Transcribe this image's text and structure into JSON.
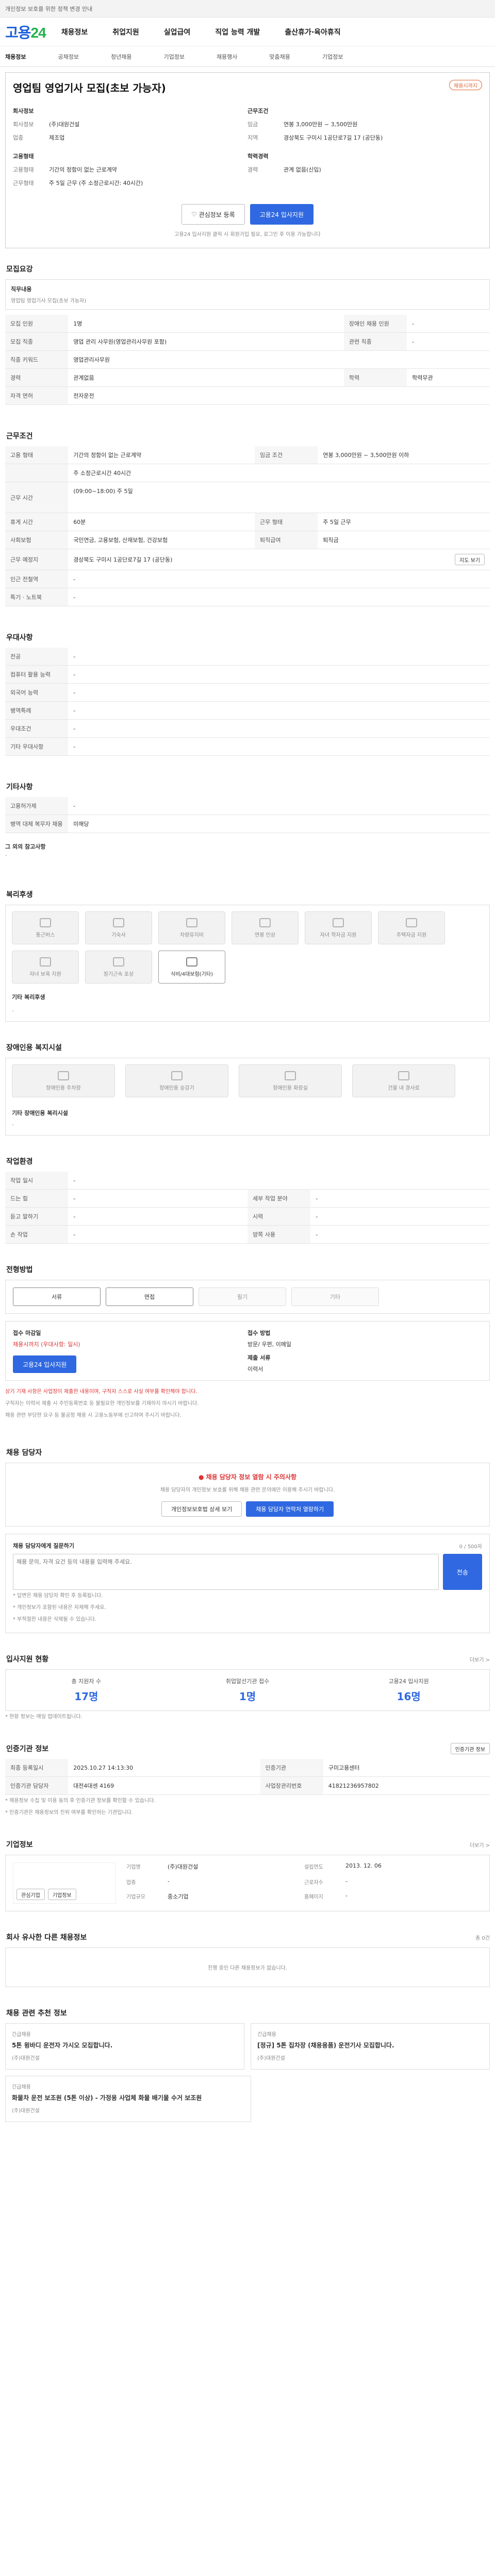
{
  "topbar": {
    "notice": "개인정보 보호를 위한 정책 변경 안내"
  },
  "gnb": {
    "logo_a": "고용",
    "logo_b": "24",
    "menu": [
      "채용정보",
      "취업지원",
      "실업급여",
      "직업 능력 개발",
      "출산휴가·육아휴직"
    ]
  },
  "sub": [
    "채용정보",
    "공채정보",
    "청년채용",
    "기업정보",
    "채용행사",
    "맞춤채용",
    "기업정보"
  ],
  "job": {
    "title": "영업팀 영업기사 모집(초보 가능자)",
    "badge": "채용시까지",
    "company_label": "회사정보",
    "company_name": "(주)대원건설",
    "company_type": "제조업",
    "cond_label": "근무조건",
    "pay_k": "임금",
    "pay": "연봉 3,000만원 ~ 3,500만원",
    "region_k": "지역",
    "region": "경상북도 구미시 1공단로7길 17 (공단동)",
    "emp_label": "고용형태",
    "emp_k1": "고용형태",
    "emp_v1": "기간의 정함이 없는 근로계약",
    "emp_k2": "근무형태",
    "emp_v2": "주 5일 근무 (주 소정근로시간: 40시간)",
    "career_label": "학력경력",
    "career_k": "경력",
    "career_v": "관계 없음(신입)",
    "btn_scrap": "관심정보 등록",
    "btn_apply": "고용24 입사지원",
    "apply_note": "고용24 입사지원 클릭 시 회원가입 필요, 로그인 후 이용 가능합니다"
  },
  "recruit": {
    "title": "모집요강",
    "duty_label": "직무내용",
    "duty_text": "영업팀 영업기사 모집(초보 가능자)",
    "rows": [
      [
        "모집 인원",
        "1명",
        "장애인 채용 인원",
        "-"
      ],
      [
        "모집 직종",
        "영업 관리 사무원(영업관리사무원 포함)",
        "관련 직종",
        "-"
      ],
      [
        "직종 키워드",
        "영업관리사무원",
        "",
        ""
      ],
      [
        "경력",
        "관계없음",
        "학력",
        "학력무관"
      ],
      [
        "자격 면허",
        "전자운전",
        "",
        ""
      ]
    ]
  },
  "work": {
    "title": "근무조건",
    "rows": [
      [
        "고용 형태",
        "기간의 정함이 없는 근로계약",
        "임금 조건",
        "연봉 3,000만원 ~ 3,500만원 이하"
      ],
      [
        "",
        "주 소정근로시간 40시간",
        "",
        ""
      ],
      [
        "근무 시간",
        "(09:00~18:00) 주 5일",
        "",
        ""
      ],
      [
        "휴게 시간",
        "60분",
        "근무 형태",
        "주 5일 근무"
      ],
      [
        "사회보험",
        "국민연금, 고용보험, 산재보험, 건강보험",
        "퇴직급여",
        "퇴직금"
      ],
      [
        "근무 예정지",
        "경상북도 구미시 1공단로7길 17 (공단동)",
        "",
        ""
      ],
      [
        "인근 전철역",
        "-",
        "",
        ""
      ],
      [
        "특기 · 노트북",
        "-",
        "",
        ""
      ]
    ],
    "map_btn": "지도 보기"
  },
  "prefer": {
    "title": "우대사항",
    "rows": [
      [
        "전공",
        "-"
      ],
      [
        "컴퓨터 활용 능력",
        "-"
      ],
      [
        "외국어 능력",
        "-"
      ],
      [
        "병역특례",
        "-"
      ],
      [
        "우대조건",
        "-"
      ],
      [
        "기타 우대사항",
        "-"
      ]
    ]
  },
  "other": {
    "title": "기타사항",
    "rows": [
      [
        "고용허가제",
        "-"
      ],
      [
        "병역 대체 복무자 채용",
        "미해당"
      ]
    ],
    "etc_label": "그 외의 참고사항"
  },
  "welfare": {
    "title": "복리후생",
    "tiles": [
      "통근버스",
      "기숙사",
      "차량유지비",
      "연봉 인상",
      "자녀 학자금 지원",
      "주택자금 지원",
      "자녀 보육 지원",
      "장기근속 포상",
      "식비/4대보험(기타)"
    ],
    "other_label": "기타 복리후생"
  },
  "disability": {
    "title": "장애인용 복지시설",
    "tiles": [
      "장애인용 주차장",
      "장애인용 승강기",
      "장애인용 화장실",
      "건물 내 경사로"
    ],
    "other_label": "기타 장애인용 복리시설"
  },
  "env": {
    "title": "작업환경",
    "rows": [
      [
        "작업 일시",
        "-",
        "",
        ""
      ],
      [
        "드는 힘",
        "-",
        "세부 작업 분야",
        "-"
      ],
      [
        "듣고 말하기",
        "-",
        "시력",
        "-"
      ],
      [
        "손 작업",
        "-",
        "양쪽 사용",
        "-"
      ]
    ]
  },
  "method": {
    "title": "전형방법",
    "chips": [
      "서류",
      "면접",
      "필기",
      "기타"
    ]
  },
  "receipt": {
    "k1": "접수 마감일",
    "v1": "채용시까지 (우대사항: 일시)",
    "k2": "접수 방법",
    "v2": "방문/ 우편, 이메일",
    "k3": "제출 서류",
    "v3": "이력서",
    "apply": "고용24 입사지원",
    "notes": [
      "상기 기재 사항은 사업장이 제출한 내용이며, 구직자 스스로 사실 여부를 확인해야 합니다.",
      "구직자는 이력서 제출 시 주민등록번호 등 불필요한 개인정보를 기재하지 마시기 바랍니다.",
      "채용 관련 부당한 요구 등 불공정 채용 시 고용노동부에 신고하여 주시기 바랍니다."
    ]
  },
  "contact": {
    "title": "채용 담당자",
    "warn": "채용 담당자 정보 열람 시 주의사항",
    "desc": "채용 담당자의 개인정보 보호를 위해 채용 관련 문의에만 이용해 주시기 바랍니다.",
    "btn1": "개인정보보호법 상세 보기",
    "btn2": "채용 담당자 연락처 열람하기"
  },
  "qna": {
    "title": "채용 담당자에게 질문하기",
    "placeholder": "채용 문의, 자격 요건 등의 내용을 입력해 주세요.",
    "count": "0 / 500자",
    "btn": "전송",
    "notes": [
      "* 답변은 채용 담당자 확인 후 등록됩니다.",
      "* 개인정보가 포함된 내용은 자제해 주세요.",
      "* 부적절한 내용은 삭제될 수 있습니다."
    ]
  },
  "status": {
    "title": "입사지원 현황",
    "more": "더보기 >",
    "items": [
      [
        "총 지원자 수",
        "17명"
      ],
      [
        "취업알선기관 접수",
        "1명"
      ],
      [
        "고용24 입사지원",
        "16명"
      ]
    ],
    "note": "* 현황 정보는 매일 업데이트됩니다."
  },
  "info": {
    "title": "인증기관 정보",
    "badge": "인증기관 정보",
    "rows": [
      [
        "최종 등록일시",
        "2025.10.27 14:13:30",
        "인증기관",
        "구미고용센터"
      ],
      [
        "인증기관 담당자",
        "대전4대센 4169",
        "사업장관리번호",
        "41821236957802"
      ]
    ],
    "notes": [
      "* 채용정보 수집 및 이용 동의 후 인증기관 정보를 확인할 수 있습니다.",
      "* 인증기관은 채용정보의 진위 여부를 확인하는 기관입니다."
    ]
  },
  "company": {
    "title": "기업정보",
    "more": "더보기 >",
    "k1": "기업명",
    "v1": "(주)대원건설",
    "k2": "업종",
    "v2": "-",
    "k3": "설립연도",
    "v3": "2013. 12. 06",
    "k4": "근로자수",
    "v4": "-",
    "k5": "기업규모",
    "v5": "중소기업",
    "k6": "홈페이지",
    "v6": "-",
    "btn1": "관심기업",
    "btn2": "기업정보"
  },
  "same": {
    "title": "회사 유사한 다른 채용정보",
    "empty": "진행 중인 다른 채용정보가 없습니다.",
    "more": "총 0건"
  },
  "rec": {
    "title": "채용 관련 추천 정보",
    "cards": [
      {
        "tag": "긴급채용",
        "text": "5톤 윙바디 운전자 가시오 모집합니다.",
        "co": "(주)대원건설"
      },
      {
        "tag": "긴급채용",
        "text": "[정규] 5톤 집차장 (채용용품) 운전기사 모집합니다.",
        "co": "(주)대원건설"
      },
      {
        "tag": "긴급채용",
        "text": "화물차 운전 보조원 (5톤 이상) - 가정용 사업체 화물 배기물 수거 보조원",
        "co": "(주)대원건설"
      }
    ]
  }
}
